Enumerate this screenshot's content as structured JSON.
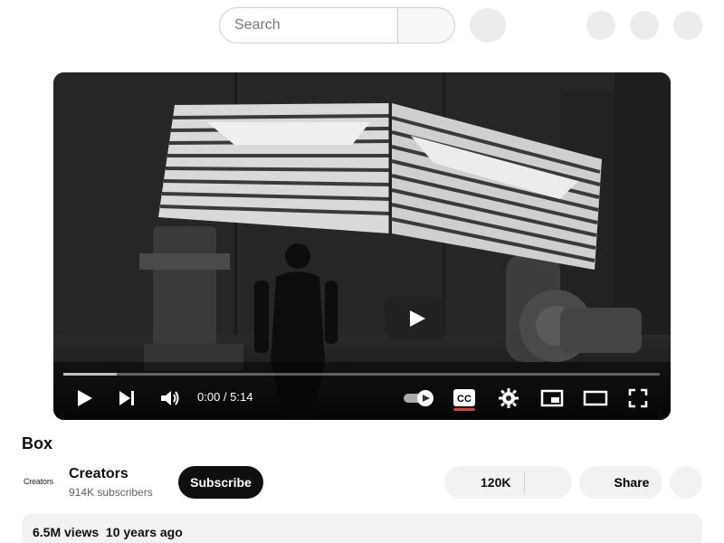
{
  "header": {
    "search_placeholder": "Search"
  },
  "player": {
    "time": "0:00 / 5:14",
    "progress_fraction": 0.09,
    "captions_on": true
  },
  "video": {
    "title": "Box"
  },
  "channel": {
    "logo_text": "Creators",
    "name": "Creators",
    "subscribers": "914K subscribers",
    "subscribe_label": "Subscribe"
  },
  "actions": {
    "likes": "120K",
    "share_label": "Share"
  },
  "description": {
    "stats": "6.5M views  10 years ago"
  },
  "colors": {
    "accent_red": "#e53935",
    "subscribe_bg": "#0f0f0f"
  }
}
